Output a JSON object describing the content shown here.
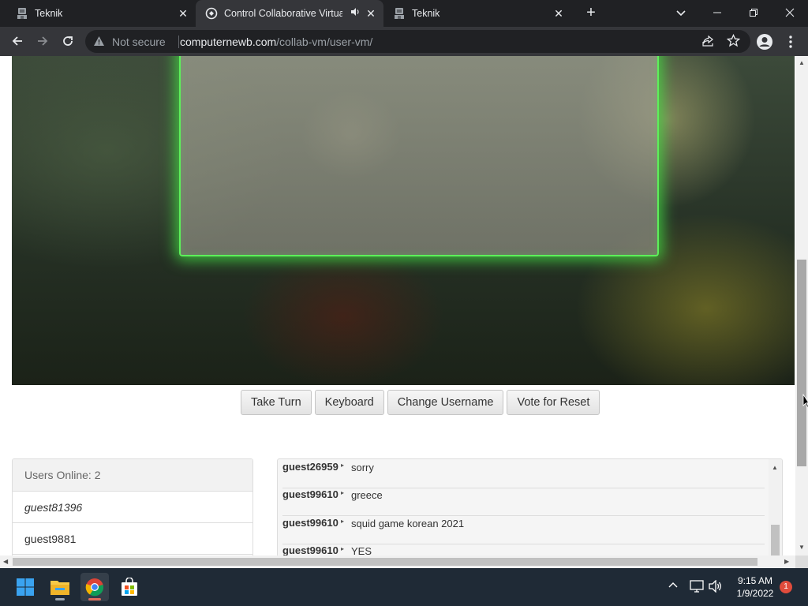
{
  "browser": {
    "tabs": [
      {
        "title": "Teknik"
      },
      {
        "title": "Control Collaborative Virtual"
      },
      {
        "title": "Teknik"
      }
    ],
    "security_label": "Not secure",
    "url_host": "computernewb.com",
    "url_path": "/collab-vm/user-vm/"
  },
  "vm_controls": {
    "take_turn": "Take Turn",
    "keyboard": "Keyboard",
    "change_username": "Change Username",
    "vote_reset": "Vote for Reset"
  },
  "users_panel": {
    "header": "Users Online: 2",
    "users": [
      "guest81396",
      "guest9881"
    ]
  },
  "chat": {
    "messages": [
      {
        "user": "guest26959",
        "text": "sorry"
      },
      {
        "user": "guest99610",
        "text": "greece"
      },
      {
        "user": "guest99610",
        "text": "squid game korean 2021"
      },
      {
        "user": "guest99610",
        "text": "YES"
      }
    ]
  },
  "taskbar": {
    "time": "9:15 AM",
    "date": "1/9/2022",
    "notification_count": "1"
  },
  "colors": {
    "chrome_dark": "#202124",
    "chrome_toolbar": "#35363a",
    "vm_glow": "#5df05a",
    "taskbar": "#1f2a36"
  },
  "icons": [
    "teknik-favicon",
    "collabvm-favicon",
    "speaker-icon",
    "close-icon",
    "new-tab-icon",
    "tab-search-icon",
    "minimize-icon",
    "restore-icon",
    "back-icon",
    "forward-icon",
    "reload-icon",
    "warning-icon",
    "share-icon",
    "star-icon",
    "profile-icon",
    "menu-icon",
    "windows-start-icon",
    "file-explorer-icon",
    "chrome-icon",
    "store-icon",
    "chevron-up-icon",
    "network-icon",
    "volume-icon"
  ]
}
